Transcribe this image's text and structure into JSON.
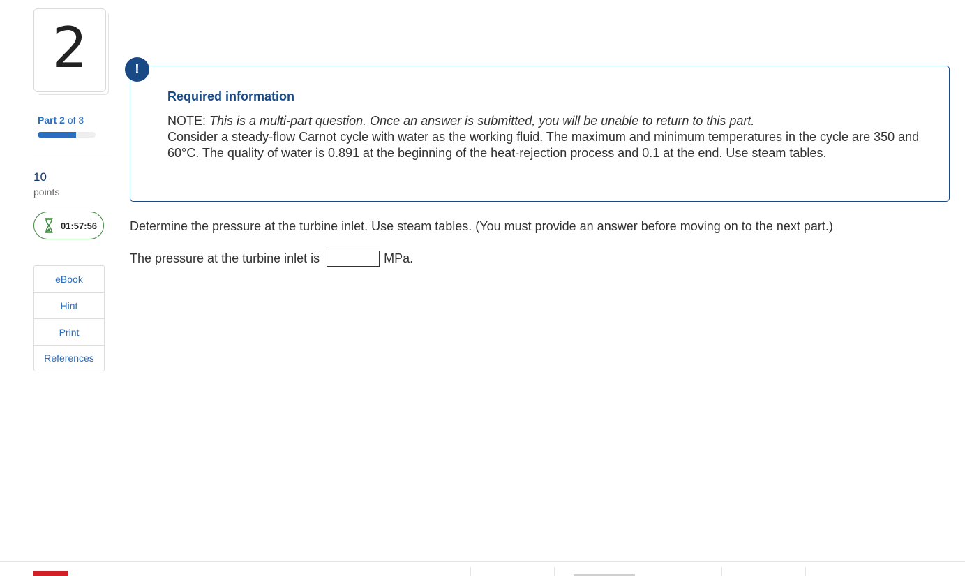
{
  "question": {
    "number": "2",
    "part_current": "Part 2",
    "part_total": "of 3",
    "part_progress_fraction": 0.667,
    "points_value": "10",
    "points_label": "points",
    "timer": "01:57:56"
  },
  "tools": [
    {
      "label": "eBook"
    },
    {
      "label": "Hint"
    },
    {
      "label": "Print"
    },
    {
      "label": "References"
    }
  ],
  "required_info": {
    "badge": "!",
    "title": "Required information",
    "note_prefix": "NOTE: ",
    "note_italic": "This is a multi-part question. Once an answer is submitted, you will be unable to return to this part.",
    "problem": "Consider a steady-flow Carnot cycle with water as the working fluid. The maximum and minimum temperatures in the cycle are 350 and 60°C. The quality of water is 0.891 at the beginning of the heat-rejection process and 0.1 at the end. Use steam tables."
  },
  "prompt": "Determine the pressure at the turbine inlet. Use steam tables. (You must provide an answer before moving on to the next part.)",
  "answer": {
    "lead_text": "The pressure at the turbine inlet is",
    "value": "",
    "unit": "MPa."
  },
  "colors": {
    "primary_blue": "#1a4a85",
    "link_blue": "#2a6ebd",
    "timer_green": "#3f8a3f",
    "brand_red": "#d32027"
  }
}
